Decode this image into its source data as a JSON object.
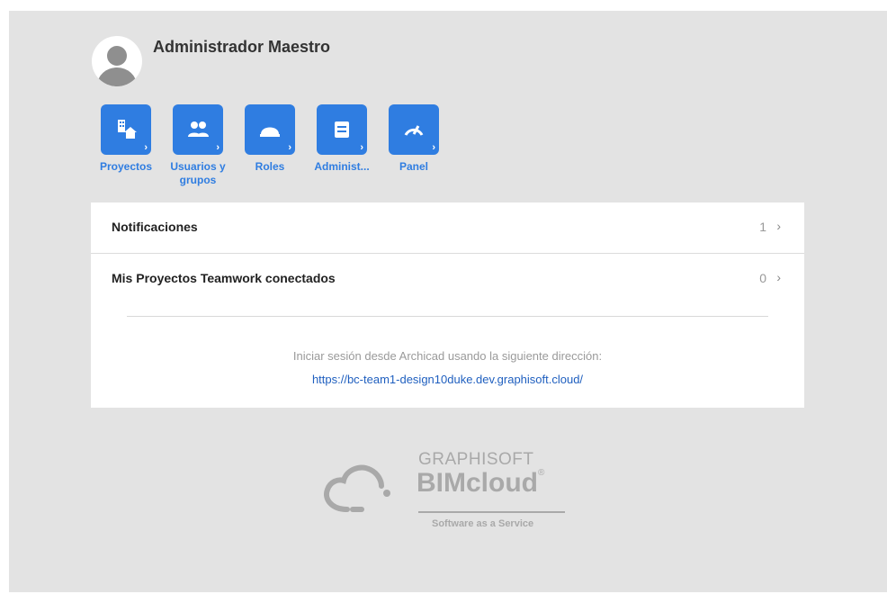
{
  "user": {
    "name": "Administrador Maestro"
  },
  "nav": [
    {
      "label": "Proyectos",
      "icon": "buildings-icon"
    },
    {
      "label": "Usuarios y grupos",
      "icon": "users-icon"
    },
    {
      "label": "Roles",
      "icon": "hardhat-icon"
    },
    {
      "label": "Administ...",
      "icon": "server-icon"
    },
    {
      "label": "Panel",
      "icon": "gauge-icon"
    }
  ],
  "rows": [
    {
      "title": "Notificaciones",
      "count": "1",
      "arrow": "›"
    },
    {
      "title": "Mis Proyectos Teamwork conectados",
      "count": "0",
      "arrow": "›"
    }
  ],
  "login": {
    "hint": "Iniciar sesión desde Archicad usando la siguiente dirección:",
    "url": "https://bc-team1-design10duke.dev.graphisoft.cloud/"
  },
  "logo": {
    "brand": "GRAPHISOFT",
    "product": "BIMcloud",
    "registered": "®",
    "tagline": "Software as a Service"
  },
  "colors": {
    "accent": "#2f7de1",
    "background": "#e3e3e3",
    "link": "#1f5fbf"
  }
}
